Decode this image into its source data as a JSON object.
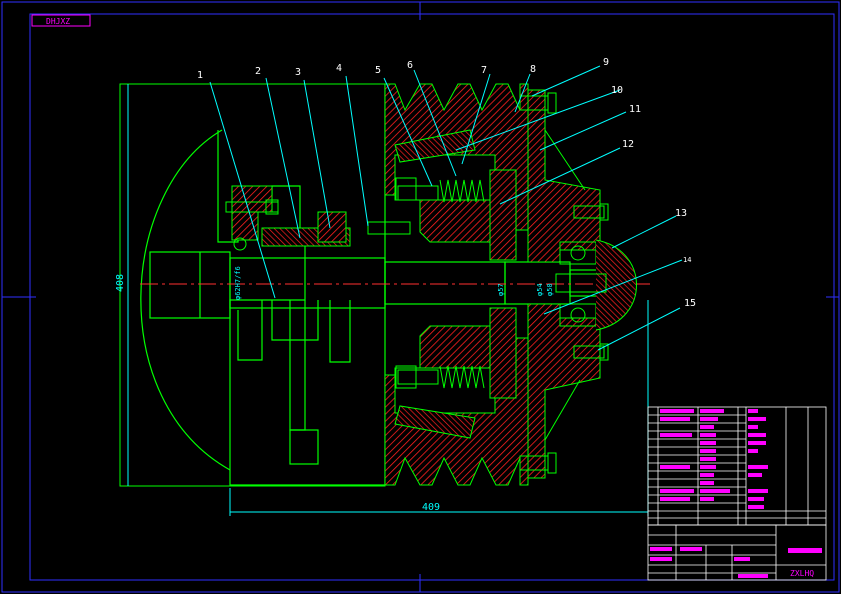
{
  "drawing": {
    "code": "DHJXZ",
    "title_block_code": "ZXLHQ"
  },
  "part_numbers": [
    "1",
    "2",
    "3",
    "4",
    "5",
    "6",
    "7",
    "8",
    "9",
    "10",
    "11",
    "12",
    "13",
    "14",
    "15"
  ],
  "dimensions": {
    "height": "408",
    "width": "409",
    "shaft_dia_left": "φ62H7/f6",
    "shaft_dia_mid": "φ57",
    "shaft_dia_right_a": "φ54",
    "shaft_dia_right_b": "φ50"
  },
  "colors": {
    "background": "#000000",
    "frame": "#2f2fff",
    "outline": "#00ff00",
    "hatch": "#ff2020",
    "leader": "#00ffff",
    "label": "#ffffff",
    "title_text": "#ff00ff",
    "centerline": "#ff3030"
  }
}
